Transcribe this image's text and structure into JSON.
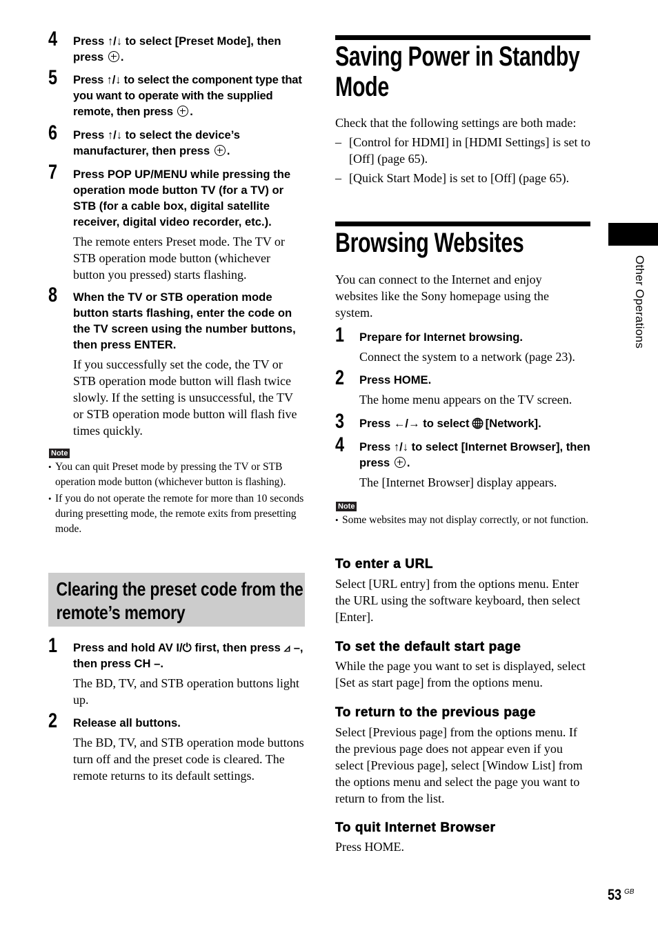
{
  "left_column": {
    "steps_top": [
      {
        "num": "4",
        "title_pre": "Press ↑/↓ to select [Preset Mode], then press",
        "title_post": "."
      },
      {
        "num": "5",
        "title_pre": "Press ↑/↓ to select the component type that you want to operate with the supplied remote, then press",
        "title_post": "."
      },
      {
        "num": "6",
        "title_pre": "Press ↑/↓ to select the device’s manufacturer, then press",
        "title_post": "."
      },
      {
        "num": "7",
        "title": "Press POP UP/MENU while pressing the operation mode button TV (for a TV) or STB (for a cable box, digital satellite receiver, digital video recorder, etc.).",
        "body": "The remote enters Preset mode. The TV or STB operation mode button (whichever button you pressed) starts flashing."
      },
      {
        "num": "8",
        "title": "When the TV or STB operation mode button starts flashing, enter the code on the TV screen using the number buttons, then press ENTER.",
        "body": "If you successfully set the code, the TV or STB operation mode button will flash twice slowly. If the setting is unsuccessful, the TV or STB operation mode button will flash five times quickly."
      }
    ],
    "note": {
      "label": "Note",
      "items": [
        "You can quit Preset mode by pressing the TV or STB operation mode button (whichever button is flashing).",
        "If you do not operate the remote for more than 10 seconds during presetting mode, the remote exits from presetting mode."
      ]
    },
    "clearing_section": {
      "heading": "Clearing the preset code from the remote’s memory",
      "steps": [
        {
          "num": "1",
          "title": "Press and hold AV I/⏻ first, then press ⊿ –, then press CH –.",
          "body": "The BD, TV, and STB operation buttons light up."
        },
        {
          "num": "2",
          "title": "Release all buttons.",
          "body": "The BD, TV, and STB operation mode buttons turn off and the preset code is cleared. The remote returns to its default settings."
        }
      ]
    }
  },
  "right_column": {
    "saving_power": {
      "title": "Saving Power in Standby Mode",
      "intro": "Check that the following settings are both made:",
      "items": [
        "[Control for HDMI] in [HDMI Settings] is set to [Off] (page 65).",
        "[Quick Start Mode] is set to [Off] (page 65)."
      ]
    },
    "browsing": {
      "title": "Browsing Websites",
      "intro": "You can connect to the Internet and enjoy websites like the Sony homepage using the system.",
      "steps": [
        {
          "num": "1",
          "title": "Prepare for Internet browsing.",
          "body": "Connect the system to a network (page 23)."
        },
        {
          "num": "2",
          "title": "Press HOME.",
          "body": "The home menu appears on the TV screen."
        },
        {
          "num": "3",
          "title_pre": "Press ←/→ to select",
          "title_post": "[Network]."
        },
        {
          "num": "4",
          "title_pre": "Press ↑/↓ to select [Internet Browser], then press",
          "title_post": ".",
          "body": "The [Internet Browser] display appears."
        }
      ],
      "note": {
        "label": "Note",
        "items": [
          "Some websites may not display correctly, or not function."
        ]
      },
      "subsections": [
        {
          "heading": "To enter a URL",
          "body": "Select [URL entry] from the options menu. Enter the URL using the software keyboard, then select [Enter]."
        },
        {
          "heading": "To set the default start page",
          "body": "While the page you want to set is displayed, select [Set as start page] from the options menu."
        },
        {
          "heading": "To return to the previous page",
          "body": "Select [Previous page] from the options menu. If the previous page does not appear even if you select [Previous page], select [Window List] from the options menu and select the page you want to return to from the list."
        },
        {
          "heading": "To quit Internet Browser",
          "body": "Press HOME."
        }
      ]
    }
  },
  "side_tab": {
    "label": "Other Operations"
  },
  "page_number": {
    "number": "53",
    "suffix": "GB"
  },
  "colors": {
    "text": "#000000",
    "section_box": "#cccccc",
    "note_badge": "#231f20"
  }
}
